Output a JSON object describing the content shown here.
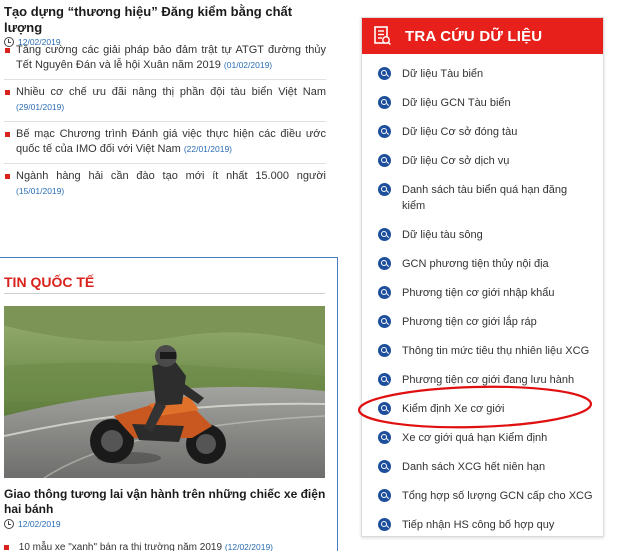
{
  "top_article": {
    "title": "Tạo dựng “thương hiệu” Đăng kiểm bằng chất lượng",
    "date": "12/02/2019"
  },
  "news": [
    {
      "text": "Tăng cường các giải pháp bảo đảm trật tự ATGT đường thủy Tết Nguyên Đán và lễ hội Xuân năm 2019",
      "date": "(01/02/2019)"
    },
    {
      "text": "Nhiều cơ chế ưu đãi nâng thị phần đội tàu biển Việt Nam",
      "date": "(29/01/2019)"
    },
    {
      "text": "Bế mạc Chương trình Đánh giá việc thực hiện các điều ước quốc tế của IMO đối với Việt Nam",
      "date": "(22/01/2019)"
    },
    {
      "text": "Ngành hàng hải cần đào tạo mới ít nhất 15.000 người",
      "date": "(15/01/2019)"
    }
  ],
  "international": {
    "heading": "TIN QUỐC TẾ",
    "title": "Giao thông tương lai vận hành trên những chiếc xe điện hai bánh",
    "date": "12/02/2019",
    "next_item": "10 mẫu xe \"xanh\" bán ra thị trường năm 2019",
    "next_date": "(12/02/2019)"
  },
  "panel": {
    "title": "TRA CỨU DỮ LIỆU",
    "items": [
      "Dữ liệu Tàu biển",
      "Dữ liệu GCN Tàu biển",
      "Dữ liệu Cơ sở đóng tàu",
      "Dữ liệu Cơ sở dịch vụ",
      "Danh sách tàu biển quá hạn đăng kiểm",
      "Dữ liệu tàu sông",
      "GCN phương tiện thủy nội địa",
      "Phương tiện cơ giới nhập khẩu",
      "Phương tiện cơ giới lắp ráp",
      "Thông tin mức tiêu thụ nhiên liệu XCG",
      "Phương tiện cơ giới đang lưu hành",
      "Kiểm định Xe cơ giới",
      "Xe cơ giới quá hạn Kiểm định",
      "Danh sách XCG hết niên hạn",
      "Tổng hợp số lượng GCN cấp cho XCG",
      "Tiếp nhận HS công bố hợp quy"
    ]
  },
  "colors": {
    "accent_red": "#e8201c",
    "link_blue": "#2a6db5",
    "icon_blue": "#1e4f9c",
    "annotation_red": "#e01010"
  }
}
